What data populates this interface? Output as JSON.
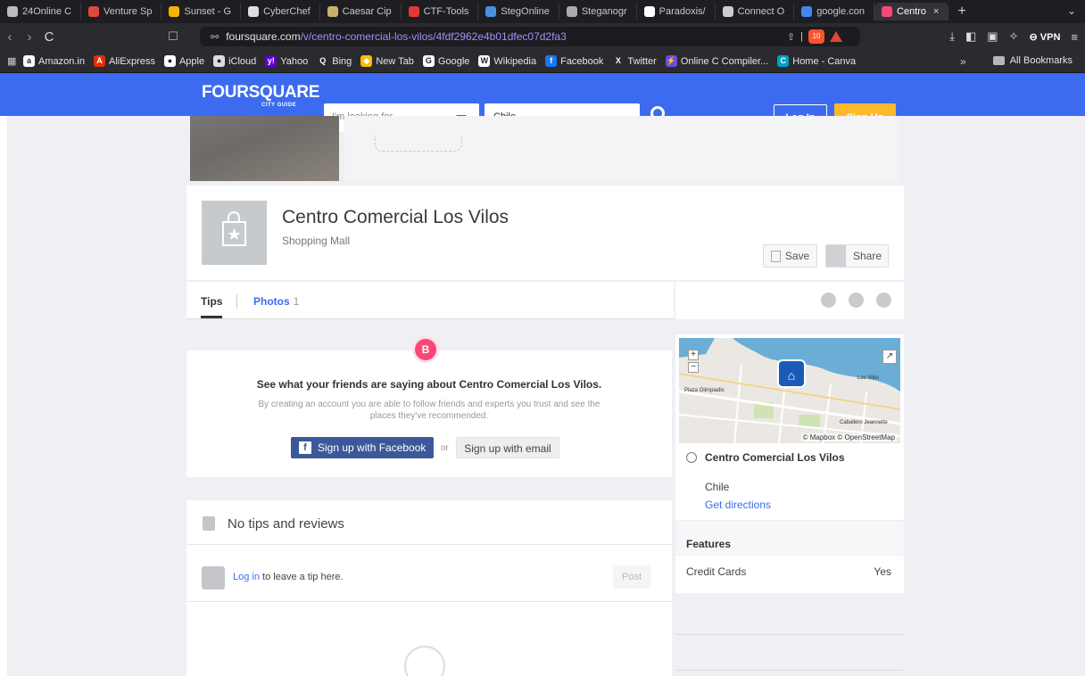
{
  "browser": {
    "tabs": [
      {
        "label": "24Online C",
        "color": "#bbbbbb"
      },
      {
        "label": "Venture Sp",
        "color": "#e0483e"
      },
      {
        "label": "Sunset - G",
        "color": "#f5b400"
      },
      {
        "label": "CyberChef",
        "color": "#dddddd"
      },
      {
        "label": "Caesar Cip",
        "color": "#c9b26b"
      },
      {
        "label": "CTF-Tools",
        "color": "#e53935"
      },
      {
        "label": "StegOnline",
        "color": "#4a90e2"
      },
      {
        "label": "Steganogr",
        "color": "#aaaaaa"
      },
      {
        "label": "Paradoxis/",
        "color": "#ffffff"
      },
      {
        "label": "Connect O",
        "color": "#cccccc"
      },
      {
        "label": "google.con",
        "color": "#4285f4"
      }
    ],
    "active_tab": {
      "label": "Centro",
      "color": "#f94877",
      "close": "×"
    },
    "new_tab": "+",
    "tab_menu": "⌄",
    "nav": {
      "back": "‹",
      "forward": "›",
      "reload": "C"
    },
    "url_domain": "foursquare.com",
    "url_path": "/v/centro-comercial-los-vilos/4fdf2962e4b01dfec07d2fa3",
    "shield_count": "10",
    "vpn_label": "VPN",
    "bookmarks": [
      {
        "label": "Amazon.in",
        "icon": "a",
        "color": "#ffffff"
      },
      {
        "label": "AliExpress",
        "icon": "A",
        "color": "#e62e04"
      },
      {
        "label": "Apple",
        "icon": "●",
        "color": "#ffffff"
      },
      {
        "label": "iCloud",
        "icon": "●",
        "color": "#dddddd"
      },
      {
        "label": "Yahoo",
        "icon": "y!",
        "color": "#6001d2"
      },
      {
        "label": "Bing",
        "icon": "Q",
        "color": "#2a2a2f"
      },
      {
        "label": "New Tab",
        "icon": "◆",
        "color": "#fbbc04"
      },
      {
        "label": "Google",
        "icon": "G",
        "color": "#ffffff"
      },
      {
        "label": "Wikipedia",
        "icon": "W",
        "color": "#ffffff"
      },
      {
        "label": "Facebook",
        "icon": "f",
        "color": "#1877f2"
      },
      {
        "label": "Twitter",
        "icon": "X",
        "color": "#2a2a2f"
      },
      {
        "label": "Online C Compiler...",
        "icon": "⚡",
        "color": "#6a4fd8"
      },
      {
        "label": "Home - Canva",
        "icon": "C",
        "color": "#00a3c4"
      }
    ],
    "bookmarks_more": "»",
    "all_bookmarks": "All Bookmarks"
  },
  "header": {
    "logo": "FOURSQUARE",
    "logo_sub": "CITY GUIDE",
    "search_placeholder": "I'm looking for...",
    "location_value": "Chile",
    "login": "Log In",
    "signup": "Sign Up"
  },
  "venue": {
    "name": "Centro Comercial Los Vilos",
    "category": "Shopping Mall",
    "save": "Save",
    "share": "Share"
  },
  "tabs": {
    "tips": "Tips",
    "photos": "Photos",
    "photos_count": "1"
  },
  "friends": {
    "badge": "B",
    "title": "See what your friends are saying about Centro Comercial Los Vilos.",
    "text": "By creating an account you are able to follow friends and experts you trust and see the places they've recommended.",
    "facebook_button": "Sign up with Facebook",
    "or": "or",
    "email_button": "Sign up with email"
  },
  "tips_section": {
    "empty": "No tips and reviews",
    "login_link": "Log in",
    "login_rest": " to leave a tip here.",
    "post": "Post"
  },
  "map": {
    "zoom_in": "+",
    "zoom_out": "−",
    "attribution": "© Mapbox © OpenStreetMap",
    "labels": [
      "Los Vilos",
      "Plaza Olimpiadis",
      "Caballero Jeannette"
    ],
    "place_name": "Centro Comercial Los Vilos",
    "city": "Chile",
    "directions": "Get directions"
  },
  "features": {
    "title": "Features",
    "rows": [
      {
        "key": "Credit Cards",
        "value": "Yes"
      }
    ]
  },
  "colors": {
    "brand": "#3c6bf0",
    "signup": "#fdb929",
    "facebook": "#3b5998"
  }
}
